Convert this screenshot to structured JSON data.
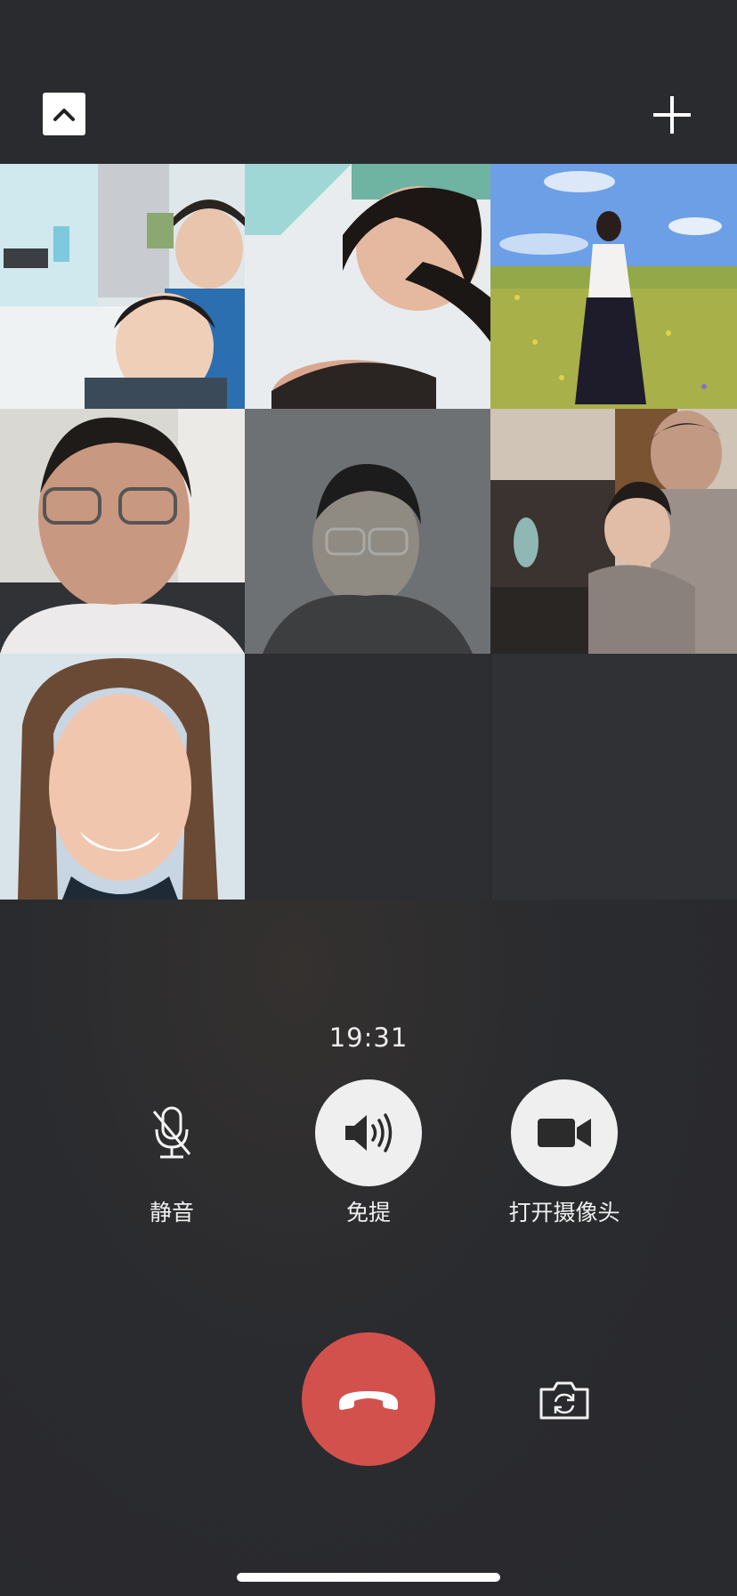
{
  "call": {
    "duration": "19:31"
  },
  "controls": {
    "mute_label": "静音",
    "speaker_label": "免提",
    "camera_label": "打开摄像头"
  },
  "icons": {
    "collapse": "chevron-up-icon",
    "add": "plus-icon",
    "mute": "microphone-off-icon",
    "speaker": "speaker-icon",
    "camera": "video-camera-icon",
    "hangup": "phone-hangup-icon",
    "flip": "camera-flip-icon"
  },
  "colors": {
    "background": "#2a2b2f",
    "hangup": "#d3514c",
    "button_light": "#efefef"
  },
  "participants": [
    {
      "video": "on"
    },
    {
      "video": "on"
    },
    {
      "video": "on"
    },
    {
      "video": "on"
    },
    {
      "video": "on"
    },
    {
      "video": "on"
    },
    {
      "video": "on"
    },
    {
      "video": "off"
    },
    {
      "video": "off"
    }
  ]
}
